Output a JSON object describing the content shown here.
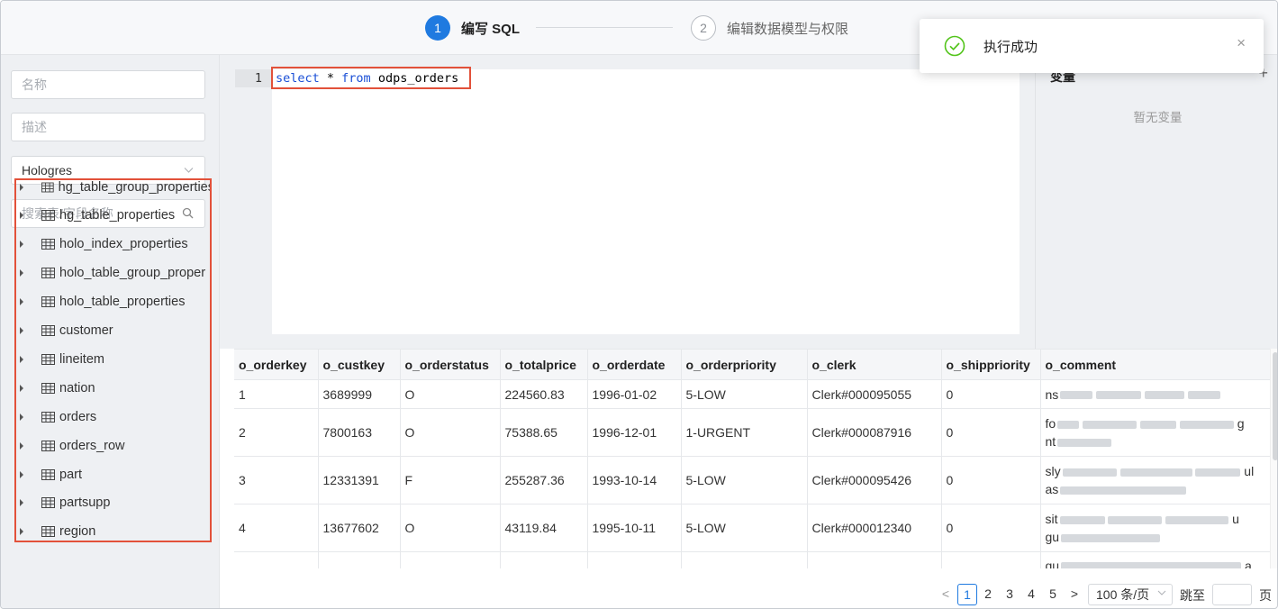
{
  "steps": [
    {
      "num": "1",
      "label": "编写 SQL",
      "active": true
    },
    {
      "num": "2",
      "label": "编辑数据模型与权限",
      "active": false
    }
  ],
  "form": {
    "name_placeholder": "名称",
    "desc_placeholder": "描述",
    "engine_value": "Hologres",
    "search_placeholder": "搜索表/字段名称"
  },
  "tree": {
    "items": [
      "hg_table_group_properties",
      "hg_table_properties",
      "holo_index_properties",
      "holo_table_group_proper",
      "holo_table_properties",
      "customer",
      "lineitem",
      "nation",
      "orders",
      "orders_row",
      "part",
      "partsupp",
      "region"
    ]
  },
  "editor": {
    "line_number": "1",
    "kw1": "select",
    "star": " * ",
    "kw2": "from",
    "table": " odps_orders"
  },
  "variables": {
    "title": "变量",
    "add": "+",
    "empty": "暂无变量"
  },
  "toast": {
    "message": "执行成功",
    "close": "×",
    "status_color": "#52c41a"
  },
  "results": {
    "columns": [
      "o_orderkey",
      "o_custkey",
      "o_orderstatus",
      "o_totalprice",
      "o_orderdate",
      "o_orderpriority",
      "o_clerk",
      "o_shippriority",
      "o_comment"
    ],
    "rows": [
      {
        "cells": [
          "1",
          "3689999",
          "O",
          "224560.83",
          "1996-01-02",
          "5-LOW",
          "Clerk#000095055",
          "0"
        ],
        "comment": [
          "ns"
        ]
      },
      {
        "cells": [
          "2",
          "7800163",
          "O",
          "75388.65",
          "1996-12-01",
          "1-URGENT",
          "Clerk#000087916",
          "0"
        ],
        "comment": [
          "fo",
          "nt"
        ],
        "comment_end": "g"
      },
      {
        "cells": [
          "3",
          "12331391",
          "F",
          "255287.36",
          "1993-10-14",
          "5-LOW",
          "Clerk#000095426",
          "0"
        ],
        "comment": [
          "sly",
          "as"
        ],
        "comment_end": "ul"
      },
      {
        "cells": [
          "4",
          "13677602",
          "O",
          "43119.84",
          "1995-10-11",
          "5-LOW",
          "Clerk#000012340",
          "0"
        ],
        "comment": [
          "sit",
          "gu"
        ],
        "comment_end": "u"
      },
      {
        "cells": [
          "",
          "",
          "",
          "",
          "",
          "",
          "",
          ""
        ],
        "comment": [
          "qu"
        ],
        "comment_end": "a"
      }
    ]
  },
  "pagination": {
    "prev": "<",
    "pages": [
      "1",
      "2",
      "3",
      "4",
      "5"
    ],
    "current": "1",
    "next": ">",
    "page_size": "100 条/页",
    "jump_label": "跳至",
    "page_label": "页"
  },
  "colors": {
    "accent": "#1f7ae0",
    "highlight_border": "#e2513a"
  }
}
